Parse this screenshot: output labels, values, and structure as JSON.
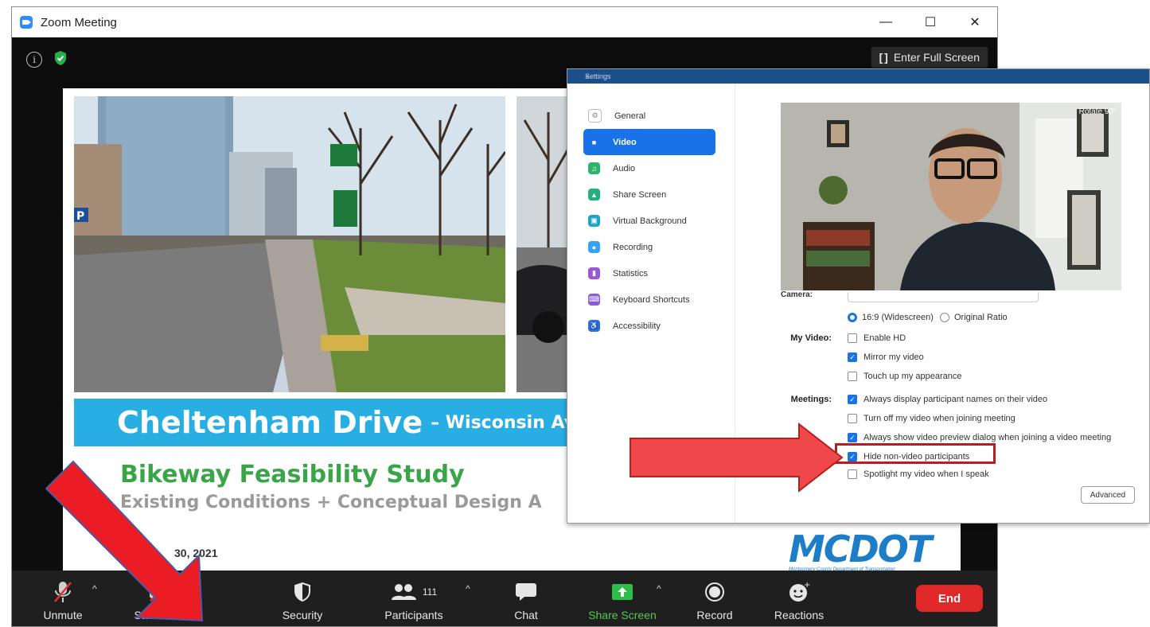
{
  "window": {
    "title": "Zoom Meeting",
    "minimize": "—",
    "maximize": "☐",
    "close": "✕",
    "enter_full_screen": "Enter Full Screen"
  },
  "slide": {
    "banner_main": "Cheltenham Drive",
    "banner_sub": "– Wisconsin Ave",
    "title": "Bikeway Feasibility Study",
    "subtitle": "Existing Conditions + Conceptual Design A",
    "date": "30, 2021",
    "logo": "MCDOT",
    "logo_sub": "Montgomery County Department of Transportation"
  },
  "toolbar": {
    "unmute": "Unmute",
    "start_video": "Start Video",
    "security": "Security",
    "participants": "Participants",
    "participant_count": "111",
    "chat": "Chat",
    "share_screen": "Share Screen",
    "record": "Record",
    "reactions": "Reactions",
    "end": "End"
  },
  "settings": {
    "title": "Settings",
    "nav": [
      {
        "label": "General",
        "color": "#cfcfcf",
        "glyph": "⚙"
      },
      {
        "label": "Video",
        "color": "#ffffff",
        "glyph": "■"
      },
      {
        "label": "Audio",
        "color": "#2db36b",
        "glyph": "♫"
      },
      {
        "label": "Share Screen",
        "color": "#22b07d",
        "glyph": "▲"
      },
      {
        "label": "Virtual Background",
        "color": "#1fa5c8",
        "glyph": "▣"
      },
      {
        "label": "Recording",
        "color": "#36a3f0",
        "glyph": "●"
      },
      {
        "label": "Statistics",
        "color": "#9b57d3",
        "glyph": "▮"
      },
      {
        "label": "Keyboard Shortcuts",
        "color": "#8a5cd6",
        "glyph": "⌨"
      },
      {
        "label": "Accessibility",
        "color": "#2f6fd6",
        "glyph": "♿"
      }
    ],
    "rotate": "Rotate 90°",
    "camera_label": "Camera:",
    "ratio_wide": "16:9 (Widescreen)",
    "ratio_original": "Original Ratio",
    "my_video_label": "My Video:",
    "meetings_label": "Meetings:",
    "options": {
      "enable_hd": "Enable HD",
      "mirror": "Mirror my video",
      "touch_up": "Touch up my appearance",
      "display_names": "Always display participant names on their video",
      "turn_off": "Turn off my video when joining meeting",
      "preview_dialog": "Always show video preview dialog when joining a video meeting",
      "hide_non_video": "Hide non-video participants",
      "spotlight": "Spotlight my video when I speak"
    },
    "advanced": "Advanced"
  }
}
